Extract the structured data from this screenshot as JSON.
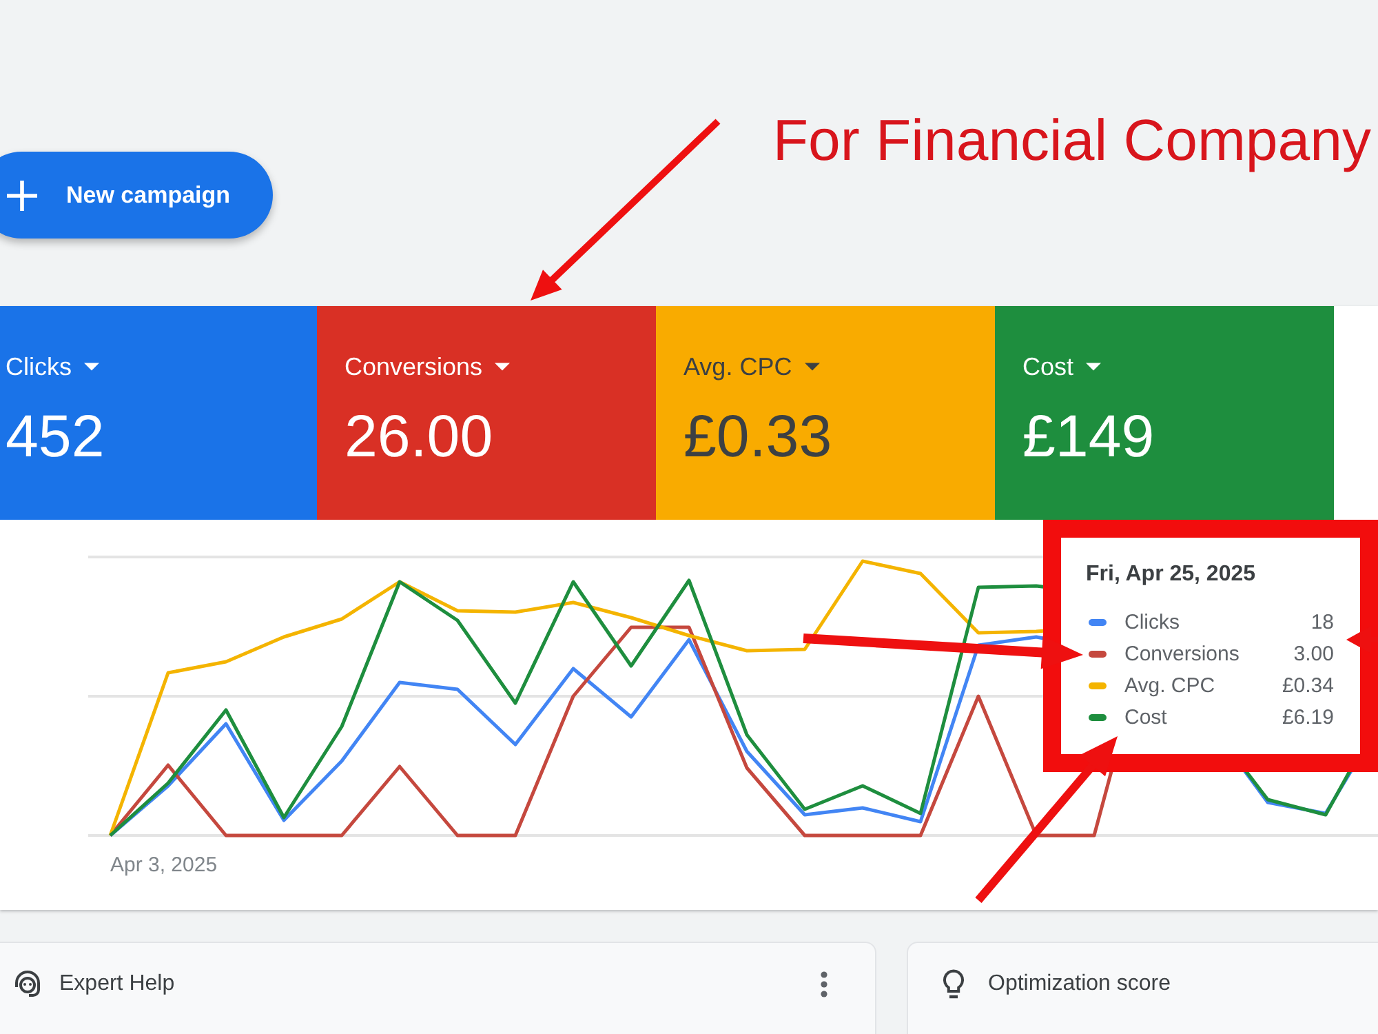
{
  "header": {
    "new_campaign_button": {
      "label": "New campaign"
    },
    "annotation": "For Financial Company"
  },
  "metrics": [
    {
      "label": "Clicks",
      "value": "452",
      "color": "#1a73e8",
      "selected": true
    },
    {
      "label": "Conversions",
      "value": "26.00",
      "color": "#d93025",
      "selected": true
    },
    {
      "label": "Avg. CPC",
      "value": "£0.33",
      "color": "#f9ab00",
      "selected": true
    },
    {
      "label": "Cost",
      "value": "£149",
      "color": "#1e8e3e",
      "selected": true
    }
  ],
  "chart": {
    "x_axis_label": "Apr 3, 2025",
    "tooltip": {
      "title": "Fri, Apr 25, 2025",
      "rows": [
        {
          "label": "Clicks",
          "value": "18",
          "color": "#4285f4"
        },
        {
          "label": "Conversions",
          "value": "3.00",
          "color": "#c5483e"
        },
        {
          "label": "Avg. CPC",
          "value": "£0.34",
          "color": "#f4b400"
        },
        {
          "label": "Cost",
          "value": "£6.19",
          "color": "#1e8e3e"
        }
      ]
    }
  },
  "cards": [
    {
      "kind": "help",
      "title": "Expert Help"
    },
    {
      "kind": "score",
      "title": "Optimization score"
    }
  ]
}
